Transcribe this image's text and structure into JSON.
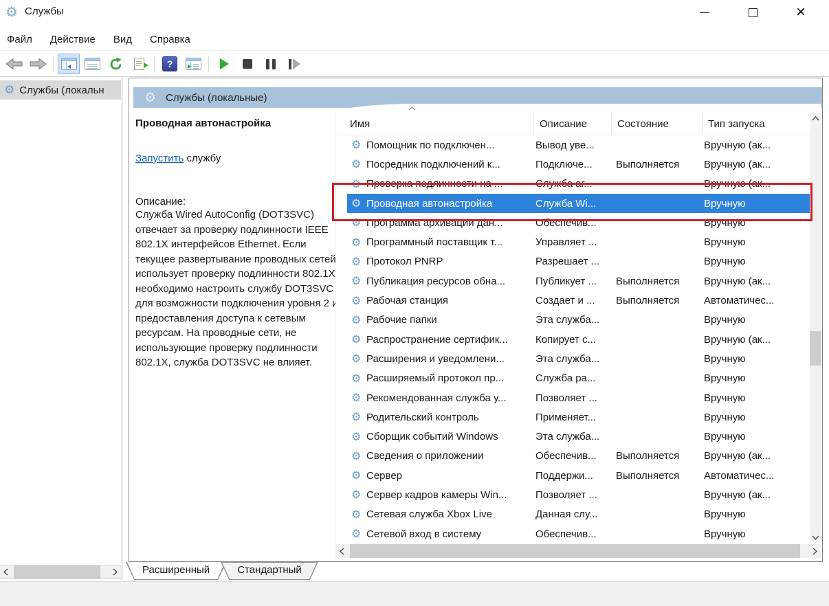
{
  "window": {
    "title": "Службы"
  },
  "menu": {
    "items": [
      "Файл",
      "Действие",
      "Вид",
      "Справка"
    ]
  },
  "toolbar": {
    "help_glyph": "?",
    "icons": [
      "back",
      "forward",
      "show-hide-console-tree",
      "properties",
      "refresh",
      "export-list",
      "help",
      "show-hide-action-pane",
      "start-service",
      "stop-service",
      "pause-service",
      "restart-service"
    ]
  },
  "tree": {
    "root_label": "Службы (локальн"
  },
  "band": {
    "title": "Службы (локальные)"
  },
  "detail": {
    "service_title": "Проводная автонастройка",
    "action_link": "Запустить",
    "action_suffix": " службу",
    "description_label": "Описание:",
    "description": "Служба Wired AutoConfig (DOT3SVC) отвечает за проверку подлинности IEEE 802.1X интерфейсов Ethernet. Если текущее развертывание проводных сетей использует проверку подлинности 802.1X, необходимо настроить службу DOT3SVC для возможности подключения уровня 2 и предоставления доступа к сетевым ресурсам. На проводные сети, не использующие проверку подлинности 802.1X, служба DOT3SVC не влияет."
  },
  "table": {
    "columns": [
      "Имя",
      "Описание",
      "Состояние",
      "Тип запуска"
    ],
    "rows": [
      {
        "name": "Помощник по подключен...",
        "desc": "Вывод уве...",
        "status": "",
        "startup": "Вручную (ак...",
        "selected": false
      },
      {
        "name": "Посредник подключений к...",
        "desc": "Подключе...",
        "status": "Выполняется",
        "startup": "Вручную (ак...",
        "selected": false
      },
      {
        "name": "Проверка подлинности на ...",
        "desc": "Служба аг...",
        "status": "",
        "startup": "Вручную (ак...",
        "selected": false
      },
      {
        "name": "Проводная автонастройка",
        "desc": "Служба Wi...",
        "status": "",
        "startup": "Вручную",
        "selected": true
      },
      {
        "name": "Программа архивации дан...",
        "desc": "Обеспечив...",
        "status": "",
        "startup": "Вручную",
        "selected": false
      },
      {
        "name": "Программный поставщик т...",
        "desc": "Управляет ...",
        "status": "",
        "startup": "Вручную",
        "selected": false
      },
      {
        "name": "Протокол PNRP",
        "desc": "Разрешает ...",
        "status": "",
        "startup": "Вручную",
        "selected": false
      },
      {
        "name": "Публикация ресурсов обна...",
        "desc": "Публикует ...",
        "status": "Выполняется",
        "startup": "Вручную (ак...",
        "selected": false
      },
      {
        "name": "Рабочая станция",
        "desc": "Создает и ...",
        "status": "Выполняется",
        "startup": "Автоматичес...",
        "selected": false
      },
      {
        "name": "Рабочие папки",
        "desc": "Эта служба...",
        "status": "",
        "startup": "Вручную",
        "selected": false
      },
      {
        "name": "Распространение сертифик...",
        "desc": "Копирует с...",
        "status": "",
        "startup": "Вручную (ак...",
        "selected": false
      },
      {
        "name": "Расширения и уведомлени...",
        "desc": "Эта служба...",
        "status": "",
        "startup": "Вручную",
        "selected": false
      },
      {
        "name": "Расширяемый протокол пр...",
        "desc": "Служба ра...",
        "status": "",
        "startup": "Вручную",
        "selected": false
      },
      {
        "name": "Рекомендованная служба у...",
        "desc": "Позволяет ...",
        "status": "",
        "startup": "Вручную",
        "selected": false
      },
      {
        "name": "Родительский контроль",
        "desc": "Применяет...",
        "status": "",
        "startup": "Вручную",
        "selected": false
      },
      {
        "name": "Сборщик событий Windows",
        "desc": "Эта служба...",
        "status": "",
        "startup": "Вручную",
        "selected": false
      },
      {
        "name": "Сведения о приложении",
        "desc": "Обеспечив...",
        "status": "Выполняется",
        "startup": "Вручную (ак...",
        "selected": false
      },
      {
        "name": "Сервер",
        "desc": "Поддержи...",
        "status": "Выполняется",
        "startup": "Автоматичес...",
        "selected": false
      },
      {
        "name": "Сервер кадров камеры Win...",
        "desc": "Позволяет ...",
        "status": "",
        "startup": "Вручную (ак...",
        "selected": false
      },
      {
        "name": "Сетевая служба Xbox Live",
        "desc": "Данная слу...",
        "status": "",
        "startup": "Вручную",
        "selected": false
      },
      {
        "name": "Сетевой вход в систему",
        "desc": "Обеспечив...",
        "status": "",
        "startup": "Вручную",
        "selected": false
      }
    ]
  },
  "tabs": {
    "items": [
      "Расширенный",
      "Стандартный"
    ],
    "active": "Расширенный"
  },
  "colors": {
    "selection_bg": "#2d82dc",
    "selection_text": "#ffffff",
    "highlight_border": "#cb2127",
    "band_bg": "#a9c2dc",
    "link": "#0a64c4",
    "help_icon_bg": "#3d55b8",
    "play_green": "#2fae2f"
  }
}
